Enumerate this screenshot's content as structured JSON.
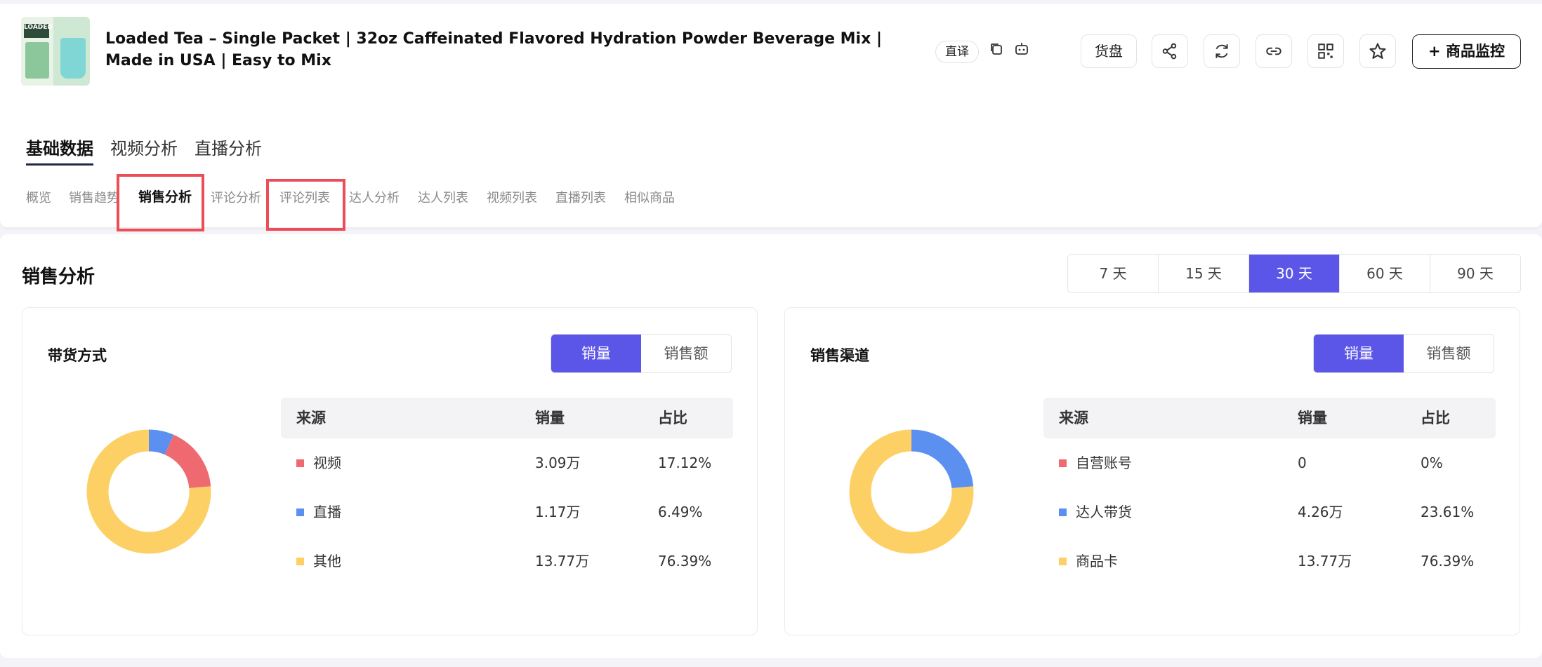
{
  "product": {
    "thumb_logo_text": "LOADED",
    "title": "Loaded Tea – Single Packet | 32oz Caffeinated Flavored Hydration Powder Beverage Mix | Made in USA | Easy to Mix",
    "translate_label": "直译"
  },
  "actions": {
    "huopan_label": "货盘",
    "monitor_label": "+ 商品监控"
  },
  "main_tabs": [
    "基础数据",
    "视频分析",
    "直播分析"
  ],
  "sub_tabs": [
    "概览",
    "销售趋势",
    "销售分析",
    "评论分析",
    "评论列表",
    "达人分析",
    "达人列表",
    "视频列表",
    "直播列表",
    "相似商品"
  ],
  "section": {
    "title": "销售分析",
    "ranges": [
      "7 天",
      "15 天",
      "30 天",
      "60 天",
      "90 天"
    ],
    "active_range": "30 天"
  },
  "panels": [
    {
      "title": "带货方式",
      "toggle": [
        "销量",
        "销售额"
      ],
      "headers": [
        "来源",
        "销量",
        "占比"
      ],
      "rows": [
        {
          "source": "视频",
          "sales": "3.09万",
          "ratio": "17.12%",
          "color": "#ef6a70",
          "pct": 17.12
        },
        {
          "source": "直播",
          "sales": "1.17万",
          "ratio": "6.49%",
          "color": "#5b8ff0",
          "pct": 6.49
        },
        {
          "source": "其他",
          "sales": "13.77万",
          "ratio": "76.39%",
          "color": "#fdd066",
          "pct": 76.39
        }
      ]
    },
    {
      "title": "销售渠道",
      "toggle": [
        "销量",
        "销售额"
      ],
      "headers": [
        "来源",
        "销量",
        "占比"
      ],
      "rows": [
        {
          "source": "自营账号",
          "sales": "0",
          "ratio": "0%",
          "color": "#ef6a70",
          "pct": 0
        },
        {
          "source": "达人带货",
          "sales": "4.26万",
          "ratio": "23.61%",
          "color": "#5b8ff0",
          "pct": 23.61
        },
        {
          "source": "商品卡",
          "sales": "13.77万",
          "ratio": "76.39%",
          "color": "#fdd066",
          "pct": 76.39
        }
      ]
    }
  ]
}
